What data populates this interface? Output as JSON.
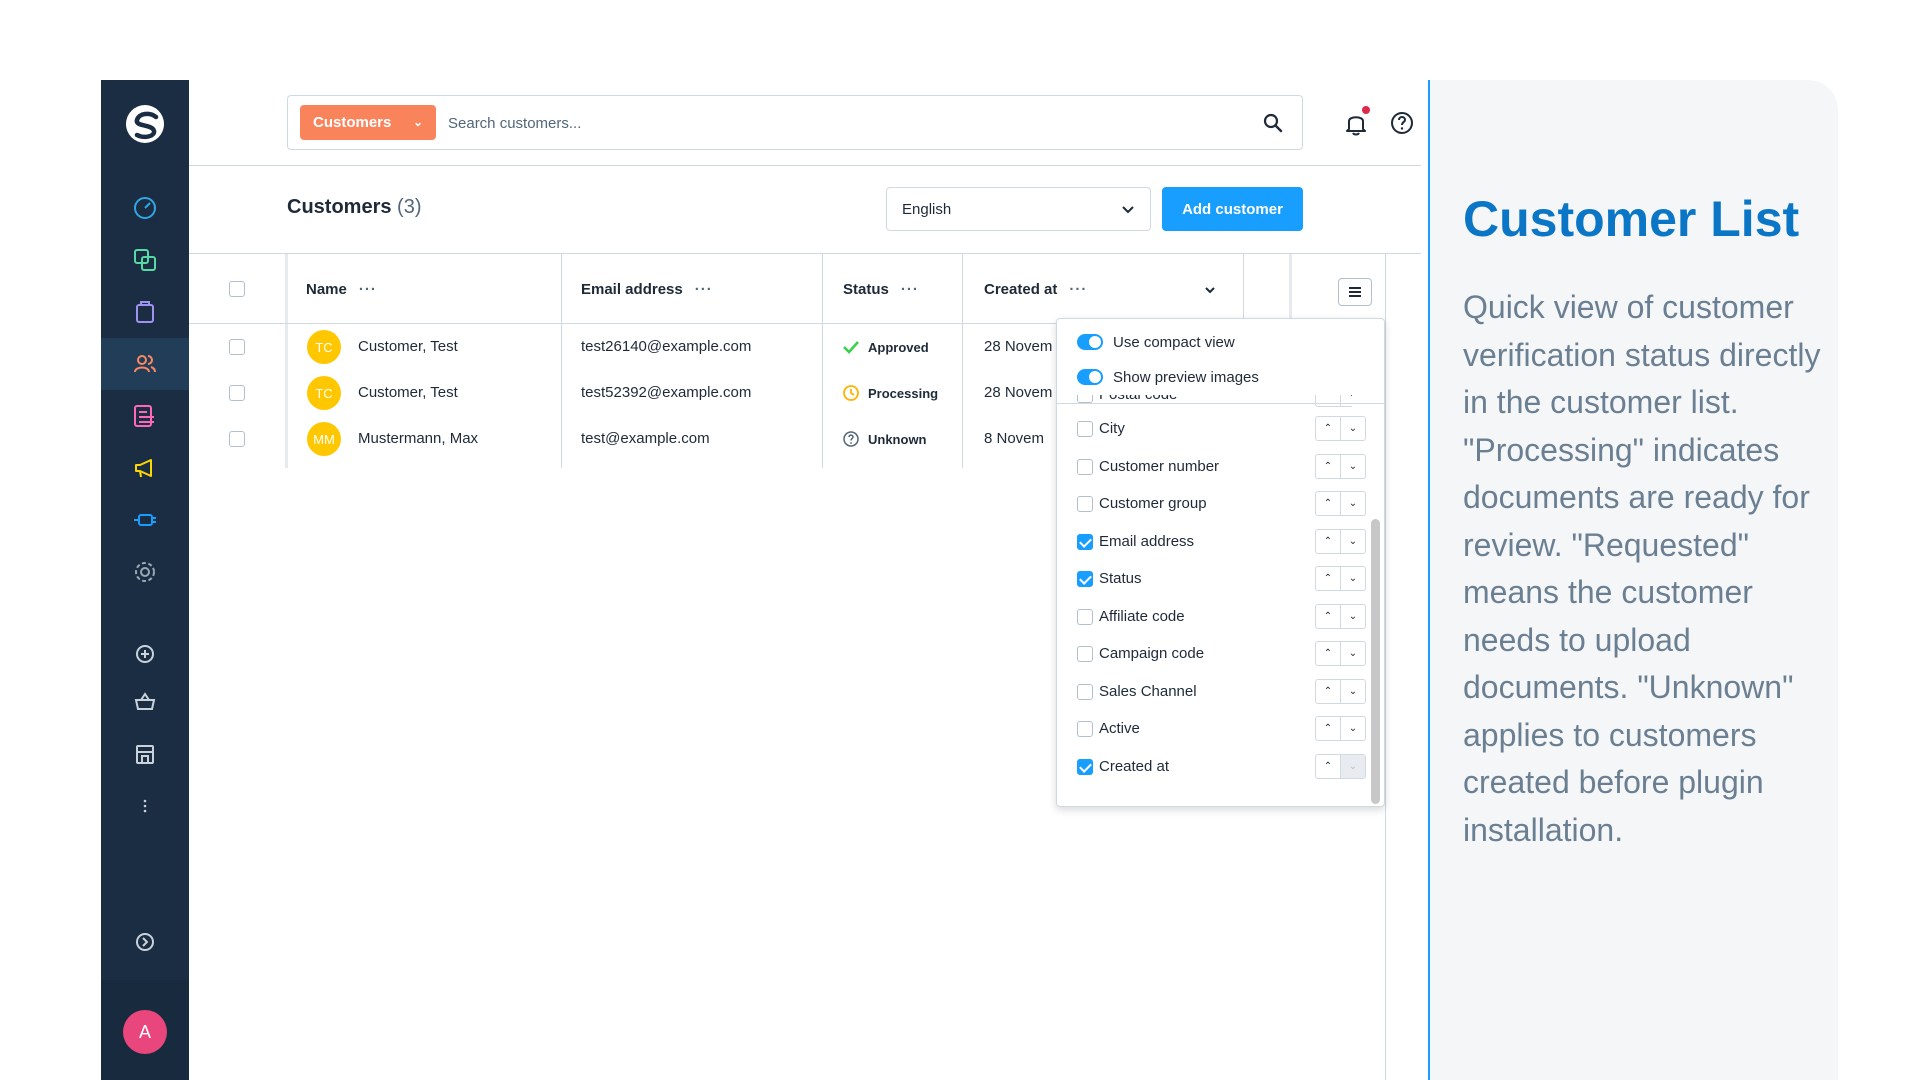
{
  "search": {
    "type_label": "Customers",
    "placeholder": "Search customers..."
  },
  "page": {
    "title": "Customers",
    "count": "(3)"
  },
  "language_select": {
    "value": "English"
  },
  "add_button": {
    "label": "Add customer"
  },
  "table": {
    "columns": [
      "Name",
      "Email address",
      "Status",
      "Created at"
    ],
    "dots": "···",
    "rows": [
      {
        "initials": "TC",
        "name": "Customer, Test",
        "email": "test26140@example.com",
        "status": "Approved",
        "created": "28 Novem"
      },
      {
        "initials": "TC",
        "name": "Customer, Test",
        "email": "test52392@example.com",
        "status": "Processing",
        "created": "28 Novem"
      },
      {
        "initials": "MM",
        "name": "Mustermann, Max",
        "email": "test@example.com",
        "status": "Unknown",
        "created": "8 Novem"
      }
    ]
  },
  "column_panel": {
    "toggles": [
      "Use compact view",
      "Show preview images"
    ],
    "partial_label": "Postal code",
    "columns": [
      {
        "label": "City",
        "checked": false
      },
      {
        "label": "Customer number",
        "checked": false
      },
      {
        "label": "Customer group",
        "checked": false
      },
      {
        "label": "Email address",
        "checked": true
      },
      {
        "label": "Status",
        "checked": true
      },
      {
        "label": "Affiliate code",
        "checked": false
      },
      {
        "label": "Campaign code",
        "checked": false
      },
      {
        "label": "Sales Channel",
        "checked": false
      },
      {
        "label": "Active",
        "checked": false
      },
      {
        "label": "Created at",
        "checked": true
      }
    ]
  },
  "user": {
    "initial": "A"
  },
  "description": {
    "title": "Customer List",
    "text": "Quick view of customer verification status directly in the customer list. \"Processing\" indicates documents are ready for review. \"Requested\" means the customer needs to upload documents. \"Unknown\" applies to customers created before plugin installation."
  },
  "colors": {
    "sidebar": "#1b2d42",
    "accent": "#189eff",
    "orange": "#f9845c",
    "title_blue": "#0b76c6"
  },
  "icons": [
    "dashboard-icon",
    "catalogue-icon",
    "orders-icon",
    "customers-icon",
    "content-icon",
    "marketing-icon",
    "extensions-icon",
    "settings-icon",
    "add-circle-icon",
    "basket-icon",
    "storefront-icon",
    "more-icon",
    "expand-icon"
  ]
}
